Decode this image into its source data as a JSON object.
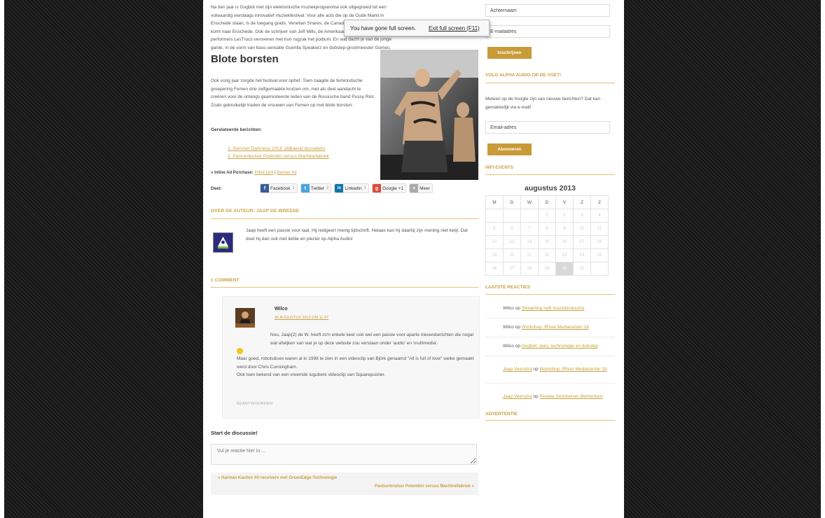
{
  "article": {
    "intro": "Na tien jaar is Gogbot met zijn elektronische muziekprogramma ook uitgegroeid tot een volwaardig vierdaags innovatief muziekfestival. Voor alle acts die op de Oude Markt in Enschede staan, is de toegang gratis. Venetian Snares, de Canadese breakcore-legende, komt naar Enschede. Ook de schrijver van Jeff Mills, de Amerikaan Dan Duitse lofi performers LesTrucs veroveren met hun rugzak het podium. En wat dacht je van de jonge garde, in de vorm van bass-sensatie Guerilla Speakerz en dubstep-grootmeester Gomes.",
    "heading": "Blote borsten",
    "paragraph": "Ook vorig jaar zorgde het festival voor ophef. Toen zaagde de feministische groepering Femen drie zelfgemaakte kruizen om, met als doel aandacht te creëren voor de onlangs gearresteerde leden van de Russische band Pussy Riot. Zoals gebruikelijk traden de vrouwen van Femen op met blote borsten.",
    "related_heading": "Gerelateerde berichten:",
    "related": [
      "1. Summer Darkness 2013: afdkaend bezoekers",
      "2. Pantserkruiser Potemkin versus Machinefabriek"
    ],
    "inline_ad_label": "» Inline Ad Purchase:",
    "inline_ad_link1": "Inline Link",
    "inline_ad_sep": "|",
    "inline_ad_link2": "Banner Ad",
    "share_label": "Deel:",
    "share": [
      {
        "icon": "facebook-icon",
        "letter": "f",
        "color": "#3b5998",
        "label": "Facebook",
        "count": "1"
      },
      {
        "icon": "twitter-icon",
        "letter": "t",
        "color": "#4aa6e0",
        "label": "Twitter",
        "count": "2"
      },
      {
        "icon": "linkedin-icon",
        "letter": "in",
        "color": "#0e76a8",
        "label": "Linkedin",
        "count": "1"
      },
      {
        "icon": "google-plus-icon",
        "letter": "g",
        "color": "#dd4b39",
        "label": "Google +1",
        "count": ""
      },
      {
        "icon": "more-icon",
        "letter": "+",
        "color": "#aaa",
        "label": "Meer",
        "count": ""
      }
    ]
  },
  "author": {
    "heading": "OVER DE AUTEUR: JAAP DE WREEDE",
    "bio": "Jaap heeft een passie voor taal. Hij redigeert menig tijdschrift. Helaas kan hij daarbij zijn mening niet kwijt. Dat doet hij dan ook met liefde en plezier op Alpha Audio!"
  },
  "comments": {
    "heading": "1 COMMENT",
    "items": [
      {
        "name": "Wilco",
        "date": "30 AUGUSTUS 2013 OM 11:47",
        "body_1": "Nou, Jaap(2) de W. heeft zo'n enkele keer ook wel een passie voor aparte nieuwsberichten die nogal wat afwijken van wat je op deze website zou verstaan onder 'audio' en 'multimedia'.",
        "body_2": "Maar goed, robots&sex waren al in 1998 te zien in een videoclip van Björk genaamd \"All is full of love\" welke gemaakt werd door Chris Cunningham.",
        "body_3": "Ook toen bekend van een vreemde lugubere videoclip van Squarepusher.",
        "reply": "BEANTWOORDEN"
      }
    ]
  },
  "discussion": {
    "heading": "Start de discussie!",
    "placeholder": "Vul je reactie hier in ..."
  },
  "post_nav": {
    "prev": "« Harman Kardon AV-receivers met GreenEdge-Technologie",
    "next": "Pantserkruiser Potemkin versus Machinefabriek »"
  },
  "sidebar": {
    "lastname_value": "Achternaam",
    "email_value": "E-mailadres",
    "subscribe_label": "Inschrijven",
    "follow_heading": "VOLG ALPHA AUDIO OP DE VOET!",
    "follow_text": "Meteen op de hoogte zijn van nieuwe berichten? Dat kan gemakkelijk via e-mail!",
    "email_placeholder": "Email-adres",
    "abonneren_label": "Abonneren",
    "hifi_heading": "HIFI EVENTS",
    "calendar": {
      "title": "augustus 2013",
      "days": [
        "M",
        "D",
        "W",
        "D",
        "V",
        "Z",
        "Z"
      ],
      "weeks": [
        [
          "",
          "",
          "",
          "1",
          "2",
          "3",
          "4"
        ],
        [
          "5",
          "6",
          "7",
          "8",
          "9",
          "10",
          "11"
        ],
        [
          "12",
          "13",
          "14",
          "15",
          "16",
          "17",
          "18"
        ],
        [
          "19",
          "20",
          "21",
          "22",
          "23",
          "24",
          "25"
        ],
        [
          "26",
          "27",
          "28",
          "29",
          "30",
          "31",
          ""
        ]
      ],
      "today": "30"
    },
    "reactions_heading": "LAATSTE REACTIES",
    "reactions": [
      {
        "author": "Wilco",
        "op": "op",
        "link": "Streaming redt muziekindustrie",
        "author_link": false
      },
      {
        "author": "Wilco",
        "op": "op",
        "link": "Workshop JRiver Mediacenter 18",
        "author_link": false
      },
      {
        "author": "Wilco",
        "op": "op",
        "link": "Gogbot: seks, technologie en dubstep",
        "author_link": false
      },
      {
        "author": "Jaap Veenstra",
        "op": "op",
        "link": "Workshop JRiver Mediacenter 18",
        "author_link": true
      },
      {
        "author": "Jaap Veenstra",
        "op": "op",
        "link": "Review Sennheiser Momentum",
        "author_link": true
      }
    ],
    "advert_heading": "ADVERTENTIE"
  },
  "fullscreen": {
    "message": "You have gone full screen.",
    "exit": "Exit full screen (F11)"
  },
  "colors": {
    "accent": "#c8a040",
    "button": "#c89a38"
  }
}
